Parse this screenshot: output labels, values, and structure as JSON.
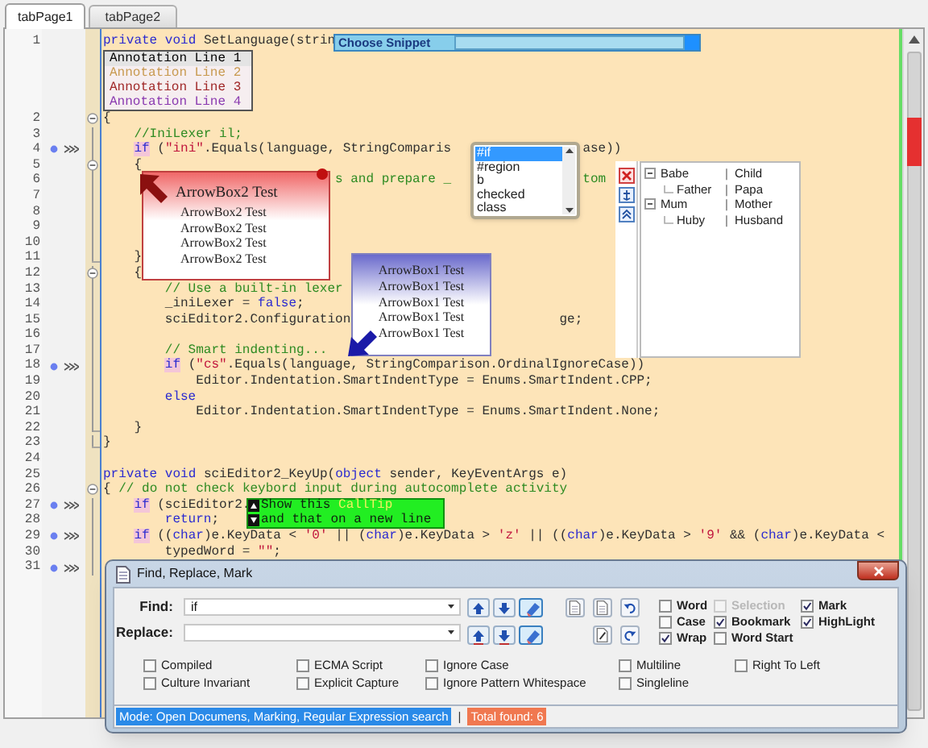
{
  "tabs": [
    {
      "label": "tabPage1",
      "selected": true
    },
    {
      "label": "tabPage2",
      "selected": false
    }
  ],
  "editor": {
    "lines": [
      {
        "number": "1",
        "bookmark": false,
        "fold_start": false,
        "in_fold": false,
        "fold_end": false,
        "tokens": [
          {
            "kind": "kw",
            "text": "private"
          },
          {
            "kind": "kw",
            "text": " void"
          },
          {
            "kind": "plain",
            "text": " SetLanguage(strin"
          }
        ],
        "annotations": [
          {
            "text": "Annotation Line 1",
            "color": "#000000"
          },
          {
            "text": "Annotation Line 2",
            "color": "#c89a50"
          },
          {
            "text": "Annotation Line 3",
            "color": "#a02828"
          },
          {
            "text": "Annotation Line 4",
            "color": "#8a3ab0"
          }
        ]
      },
      {
        "number": "2",
        "bookmark": false,
        "fold_start": true,
        "in_fold": false,
        "fold_end": false,
        "tokens": [
          {
            "kind": "plain",
            "text": "{"
          }
        ]
      },
      {
        "number": "3",
        "bookmark": false,
        "fold_start": false,
        "in_fold": true,
        "fold_end": false,
        "tokens": [
          {
            "kind": "comment",
            "text": "    //IniLexer il;"
          }
        ]
      },
      {
        "number": "4",
        "bookmark": true,
        "fold_start": false,
        "in_fold": true,
        "fold_end": false,
        "tokens": [
          {
            "kind": "match",
            "text": "    if"
          },
          {
            "kind": "plain",
            "text": " ("
          },
          {
            "kind": "str",
            "text": "\"ini\""
          },
          {
            "kind": "plain",
            "text": ".Equals(language, StringComparis"
          },
          {
            "kind": "plain",
            "text": "                 ase))"
          }
        ]
      },
      {
        "number": "5",
        "bookmark": false,
        "fold_start": true,
        "in_fold": true,
        "fold_end": false,
        "tokens": [
          {
            "kind": "plain",
            "text": "    {"
          }
        ]
      },
      {
        "number": "6",
        "bookmark": false,
        "fold_start": false,
        "in_fold": true,
        "fold_end": false,
        "tokens": [
          {
            "kind": "comment",
            "text": "                              s and prepare _"
          },
          {
            "kind": "comment",
            "text": "                 tom"
          }
        ]
      },
      {
        "number": "7",
        "bookmark": false,
        "fold_start": false,
        "in_fold": true,
        "fold_end": false
      },
      {
        "number": "8",
        "bookmark": false,
        "fold_start": false,
        "in_fold": true,
        "fold_end": false
      },
      {
        "number": "9",
        "bookmark": false,
        "fold_start": false,
        "in_fold": true,
        "fold_end": false
      },
      {
        "number": "10",
        "bookmark": false,
        "fold_start": false,
        "in_fold": true,
        "fold_end": false
      },
      {
        "number": "11",
        "bookmark": false,
        "fold_start": false,
        "in_fold": true,
        "fold_end": true,
        "tokens": [
          {
            "kind": "plain",
            "text": "    }"
          }
        ]
      },
      {
        "number": "12",
        "bookmark": false,
        "fold_start": true,
        "in_fold": true,
        "fold_end": false,
        "tokens": [
          {
            "kind": "plain",
            "text": "    {"
          }
        ]
      },
      {
        "number": "13",
        "bookmark": false,
        "fold_start": false,
        "in_fold": true,
        "fold_end": false,
        "tokens": [
          {
            "kind": "comment",
            "text": "        // Use a built-in lexer"
          }
        ]
      },
      {
        "number": "14",
        "bookmark": false,
        "fold_start": false,
        "in_fold": true,
        "fold_end": false,
        "tokens": [
          {
            "kind": "plain",
            "text": "        _iniLexer = "
          },
          {
            "kind": "kw",
            "text": "false"
          },
          {
            "kind": "plain",
            "text": ";"
          }
        ]
      },
      {
        "number": "15",
        "bookmark": false,
        "fold_start": false,
        "in_fold": true,
        "fold_end": false,
        "tokens": [
          {
            "kind": "plain",
            "text": "        sciEditor2.Configuration"
          },
          {
            "kind": "plain",
            "text": "                           ge;"
          }
        ]
      },
      {
        "number": "16",
        "bookmark": false,
        "fold_start": false,
        "in_fold": true,
        "fold_end": false
      },
      {
        "number": "17",
        "bookmark": false,
        "fold_start": false,
        "in_fold": true,
        "fold_end": false,
        "tokens": [
          {
            "kind": "comment",
            "text": "        // Smart indenting..."
          }
        ]
      },
      {
        "number": "18",
        "bookmark": true,
        "fold_start": false,
        "in_fold": true,
        "fold_end": false,
        "tokens": [
          {
            "kind": "match",
            "text": "        if"
          },
          {
            "kind": "plain",
            "text": " ("
          },
          {
            "kind": "str",
            "text": "\"cs\""
          },
          {
            "kind": "plain",
            "text": ".Equals(language, StringComparison.OrdinalIgnoreCase))"
          }
        ]
      },
      {
        "number": "19",
        "bookmark": false,
        "fold_start": false,
        "in_fold": true,
        "fold_end": false,
        "tokens": [
          {
            "kind": "plain",
            "text": "            Editor.Indentation.SmartIndentType = Enums.SmartIndent.CPP;"
          }
        ]
      },
      {
        "number": "20",
        "bookmark": false,
        "fold_start": false,
        "in_fold": true,
        "fold_end": false,
        "tokens": [
          {
            "kind": "kw",
            "text": "        else"
          }
        ]
      },
      {
        "number": "21",
        "bookmark": false,
        "fold_start": false,
        "in_fold": true,
        "fold_end": false,
        "tokens": [
          {
            "kind": "plain",
            "text": "            Editor.Indentation.SmartIndentType = Enums.SmartIndent.None;"
          }
        ]
      },
      {
        "number": "22",
        "bookmark": false,
        "fold_start": false,
        "in_fold": true,
        "fold_end": true,
        "tokens": [
          {
            "kind": "plain",
            "text": "    }"
          }
        ]
      },
      {
        "number": "23",
        "bookmark": false,
        "fold_start": false,
        "in_fold": true,
        "fold_end": true,
        "tokens": [
          {
            "kind": "plain",
            "text": "}"
          }
        ]
      },
      {
        "number": "24",
        "bookmark": false,
        "fold_start": false,
        "in_fold": false,
        "fold_end": false
      },
      {
        "number": "25",
        "bookmark": false,
        "fold_start": false,
        "in_fold": false,
        "fold_end": false,
        "tokens": [
          {
            "kind": "kw",
            "text": "private"
          },
          {
            "kind": "kw",
            "text": " void"
          },
          {
            "kind": "plain",
            "text": " sciEditor2_KeyUp("
          },
          {
            "kind": "kw",
            "text": "object"
          },
          {
            "kind": "plain",
            "text": " sender, KeyEventArgs e)"
          }
        ]
      },
      {
        "number": "26",
        "bookmark": false,
        "fold_start": true,
        "in_fold": false,
        "fold_end": false,
        "tokens": [
          {
            "kind": "plain",
            "text": "{"
          },
          {
            "kind": "comment",
            "text": " // do not check keybord input during autocomplete activity"
          }
        ]
      },
      {
        "number": "27",
        "bookmark": true,
        "fold_start": false,
        "in_fold": true,
        "fold_end": false,
        "tokens": [
          {
            "kind": "match",
            "text": "    if"
          },
          {
            "kind": "plain",
            "text": " (sciEditor2."
          }
        ]
      },
      {
        "number": "28",
        "bookmark": false,
        "fold_start": false,
        "in_fold": true,
        "fold_end": false,
        "tokens": [
          {
            "kind": "kw",
            "text": "        return"
          },
          {
            "kind": "plain",
            "text": ";"
          }
        ]
      },
      {
        "number": "29",
        "bookmark": true,
        "fold_start": false,
        "in_fold": true,
        "fold_end": false,
        "tokens": [
          {
            "kind": "match",
            "text": "    if"
          },
          {
            "kind": "plain",
            "text": " (("
          },
          {
            "kind": "kw",
            "text": "char"
          },
          {
            "kind": "plain",
            "text": ")e.KeyData < "
          },
          {
            "kind": "str",
            "text": "'0'"
          },
          {
            "kind": "plain",
            "text": " || ("
          },
          {
            "kind": "kw",
            "text": "char"
          },
          {
            "kind": "plain",
            "text": ")e.KeyData > "
          },
          {
            "kind": "str",
            "text": "'z'"
          },
          {
            "kind": "plain",
            "text": " || (("
          },
          {
            "kind": "kw",
            "text": "char"
          },
          {
            "kind": "plain",
            "text": ")e.KeyData > "
          },
          {
            "kind": "str",
            "text": "'9'"
          },
          {
            "kind": "plain",
            "text": " && ("
          },
          {
            "kind": "kw",
            "text": "char"
          },
          {
            "kind": "plain",
            "text": ")e.KeyData <"
          }
        ]
      },
      {
        "number": "30",
        "bookmark": false,
        "fold_start": false,
        "in_fold": true,
        "fold_end": false,
        "tokens": [
          {
            "kind": "plain",
            "text": "        typedWord = "
          },
          {
            "kind": "str",
            "text": "\"\""
          },
          {
            "kind": "plain",
            "text": ";"
          }
        ]
      },
      {
        "number": "31",
        "bookmark": true,
        "fold_start": false,
        "in_fold": true,
        "fold_end": false
      }
    ]
  },
  "snippet_bar": {
    "label": "Choose Snippet"
  },
  "autocomplete": {
    "items": [
      {
        "label": "#if",
        "selected": true
      },
      {
        "label": "#region",
        "selected": false
      },
      {
        "label": "b",
        "selected": false
      },
      {
        "label": "checked",
        "selected": false
      },
      {
        "label": "class",
        "selected": false
      }
    ]
  },
  "arrow_box_2": {
    "title": "ArrowBox2 Test",
    "lines": [
      "ArrowBox2 Test",
      "ArrowBox2 Test",
      "ArrowBox2 Test",
      "ArrowBox2 Test"
    ]
  },
  "arrow_box_1": {
    "lines": [
      "ArrowBox1 Test",
      "ArrowBox1 Test",
      "ArrowBox1 Test",
      "ArrowBox1 Test",
      "ArrowBox1 Test"
    ]
  },
  "tree": {
    "rows": [
      {
        "name": "Babe",
        "separator": "|",
        "value": "Child",
        "expanded": true,
        "children": [
          {
            "name": "Father",
            "separator": "|",
            "value": "Papa"
          }
        ]
      },
      {
        "name": "Mum",
        "separator": "|",
        "value": "Mother",
        "expanded": true,
        "children": [
          {
            "name": "Huby",
            "separator": "|",
            "value": "Husband"
          }
        ]
      }
    ]
  },
  "calltip": {
    "lines": [
      {
        "kind": "up",
        "parts": [
          {
            "text": "Show this ",
            "emphasis": false
          },
          {
            "text": "CallTip",
            "emphasis": true
          }
        ]
      },
      {
        "kind": "down",
        "parts": [
          {
            "text": "and that on a new line",
            "emphasis": false
          }
        ]
      }
    ]
  },
  "find_dialog": {
    "title": "Find, Replace, Mark",
    "find": {
      "label": "Find:",
      "value": "if"
    },
    "replace": {
      "label": "Replace:"
    },
    "options": [
      {
        "label": "Word",
        "checked": false,
        "disabled": false
      },
      {
        "label": "Case",
        "checked": false,
        "disabled": false
      },
      {
        "label": "Wrap",
        "checked": true,
        "disabled": false
      },
      {
        "label": "Selection",
        "checked": false,
        "disabled": true
      },
      {
        "label": "Bookmark",
        "checked": true,
        "disabled": false
      },
      {
        "label": "Word Start",
        "checked": false,
        "disabled": false
      },
      {
        "label": "Mark",
        "checked": true,
        "disabled": false
      },
      {
        "label": "HighLight",
        "checked": true,
        "disabled": false
      }
    ],
    "regex_options": [
      {
        "label": "Compiled",
        "checked": false
      },
      {
        "label": "Culture Invariant",
        "checked": false
      },
      {
        "label": "ECMA Script",
        "checked": false
      },
      {
        "label": "Explicit Capture",
        "checked": false
      },
      {
        "label": "Ignore Case",
        "checked": false
      },
      {
        "label": "Ignore Pattern Whitespace",
        "checked": false
      },
      {
        "label": "Multiline",
        "checked": false
      },
      {
        "label": "Singleline",
        "checked": false
      },
      {
        "label": "Right To Left",
        "checked": false
      }
    ],
    "status": {
      "mode": "Mode: Open Documens, Marking, Regular Expression search",
      "separator": "|",
      "total": "Total found: 6"
    }
  }
}
